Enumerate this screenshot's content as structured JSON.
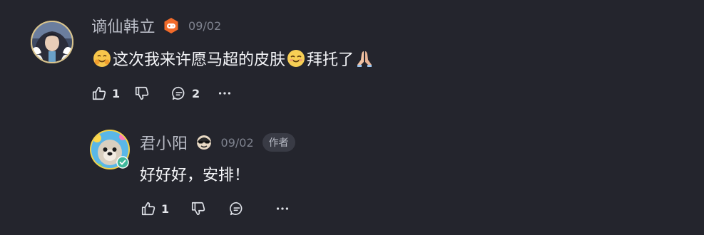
{
  "comments": [
    {
      "username": "谪仙韩立",
      "date": "09/02",
      "text_part1": "这次我来许愿马超的皮肤",
      "text_part2": "拜托了",
      "likes": "1",
      "replies": "2",
      "badge_icon": "gamepad-badge-icon"
    },
    {
      "username": "君小阳",
      "date": "09/02",
      "author_tag": "作者",
      "text": "好好好，安排！",
      "likes": "1",
      "badge_icon": "sunglasses-badge-icon"
    }
  ],
  "colors": {
    "background": "#24252d",
    "username": "#b9bcc6",
    "date": "#7f838f",
    "text": "#f4f5f8",
    "badge_orange": "#f26b2a"
  }
}
